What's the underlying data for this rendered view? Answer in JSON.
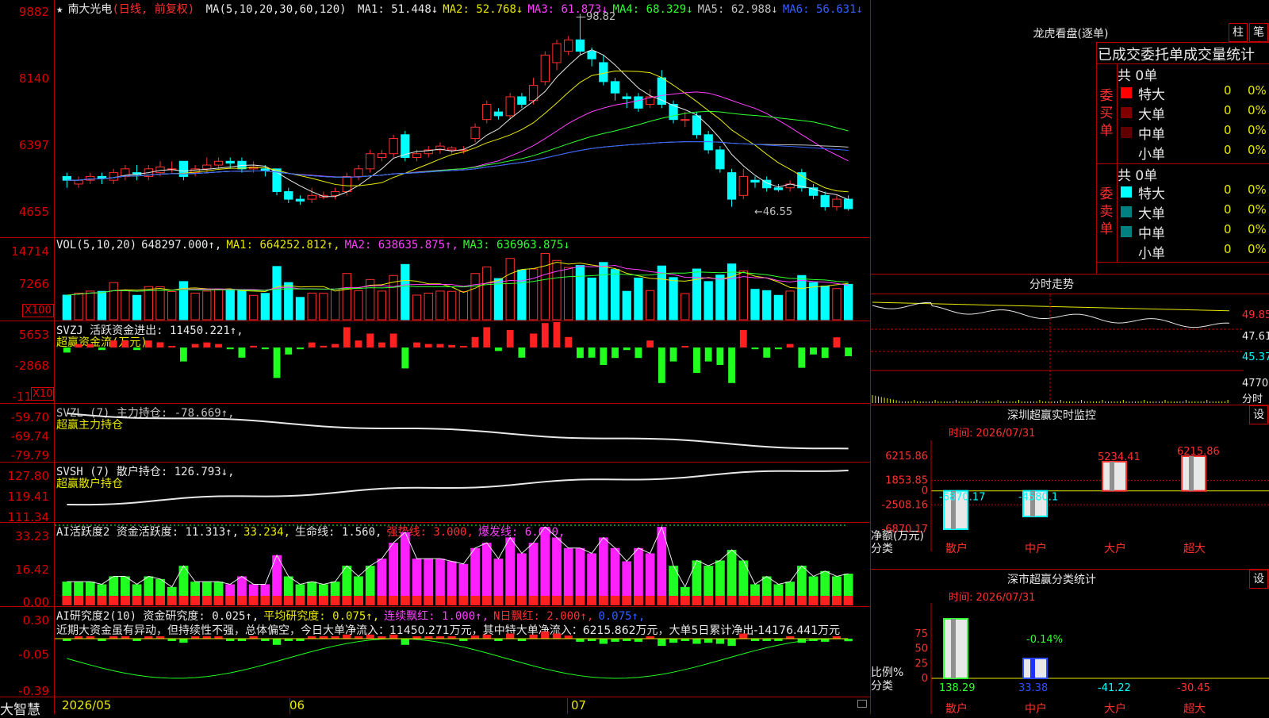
{
  "main": {
    "star": "★",
    "stock_name": "南大光电",
    "period": "(日线, 前复权)",
    "ma_params": "MA(5,10,20,30,60,120)",
    "ma": [
      {
        "label": "MA1: 51.448↓",
        "color": "#e8e8e8"
      },
      {
        "label": "MA2: 52.768↓",
        "color": "#e8e800"
      },
      {
        "label": "MA3: 61.873↓",
        "color": "#ff40ff"
      },
      {
        "label": "MA4: 68.329↓",
        "color": "#30ff30"
      },
      {
        "label": "MA5: 62.988↓",
        "color": "#c0c0c0"
      },
      {
        "label": "MA6: 56.631↓",
        "color": "#3060ff"
      }
    ],
    "y_labels": [
      "9882",
      "8140",
      "6397",
      "4655"
    ],
    "high_marker": "98.82",
    "low_marker": "←46.55",
    "candles": [
      {
        "o": 56,
        "c": 55,
        "h": 57,
        "l": 53
      },
      {
        "o": 54,
        "c": 55,
        "h": 56,
        "l": 53
      },
      {
        "o": 55,
        "c": 56,
        "h": 57,
        "l": 54
      },
      {
        "o": 56,
        "c": 55.5,
        "h": 57,
        "l": 54
      },
      {
        "o": 55,
        "c": 57,
        "h": 58,
        "l": 54
      },
      {
        "o": 56,
        "c": 58,
        "h": 59,
        "l": 55
      },
      {
        "o": 57,
        "c": 56.5,
        "h": 59,
        "l": 55
      },
      {
        "o": 56,
        "c": 58,
        "h": 59,
        "l": 55
      },
      {
        "o": 57,
        "c": 58.5,
        "h": 60,
        "l": 56
      },
      {
        "o": 58,
        "c": 58,
        "h": 60,
        "l": 57
      },
      {
        "o": 60,
        "c": 56,
        "h": 60,
        "l": 55
      },
      {
        "o": 57,
        "c": 58,
        "h": 59,
        "l": 56
      },
      {
        "o": 58,
        "c": 59,
        "h": 61,
        "l": 57
      },
      {
        "o": 59,
        "c": 60,
        "h": 61,
        "l": 58
      },
      {
        "o": 60,
        "c": 59.5,
        "h": 61,
        "l": 58
      },
      {
        "o": 60,
        "c": 58,
        "h": 61,
        "l": 57
      },
      {
        "o": 58,
        "c": 58.5,
        "h": 60,
        "l": 57
      },
      {
        "o": 58,
        "c": 57.5,
        "h": 59,
        "l": 56
      },
      {
        "o": 58,
        "c": 52,
        "h": 58,
        "l": 51
      },
      {
        "o": 52,
        "c": 50,
        "h": 53,
        "l": 49
      },
      {
        "o": 50,
        "c": 49.5,
        "h": 51,
        "l": 48.5
      },
      {
        "o": 50,
        "c": 51,
        "h": 53,
        "l": 49
      },
      {
        "o": 50.5,
        "c": 51,
        "h": 52,
        "l": 50
      },
      {
        "o": 51,
        "c": 52,
        "h": 53,
        "l": 50
      },
      {
        "o": 52,
        "c": 56,
        "h": 57,
        "l": 51
      },
      {
        "o": 56,
        "c": 58,
        "h": 59,
        "l": 55
      },
      {
        "o": 58,
        "c": 62,
        "h": 63,
        "l": 57
      },
      {
        "o": 61,
        "c": 62,
        "h": 63,
        "l": 60
      },
      {
        "o": 62,
        "c": 66,
        "h": 67,
        "l": 61
      },
      {
        "o": 67,
        "c": 61,
        "h": 68,
        "l": 60
      },
      {
        "o": 61,
        "c": 62,
        "h": 63,
        "l": 60
      },
      {
        "o": 62,
        "c": 63,
        "h": 64,
        "l": 61
      },
      {
        "o": 63,
        "c": 64,
        "h": 65,
        "l": 62
      },
      {
        "o": 63,
        "c": 63.5,
        "h": 64,
        "l": 62
      },
      {
        "o": 63,
        "c": 63,
        "h": 64,
        "l": 62
      },
      {
        "o": 66,
        "c": 69,
        "h": 70,
        "l": 65
      },
      {
        "o": 71,
        "c": 75,
        "h": 76,
        "l": 70
      },
      {
        "o": 73,
        "c": 72,
        "h": 74,
        "l": 71
      },
      {
        "o": 72,
        "c": 77,
        "h": 78,
        "l": 71
      },
      {
        "o": 77,
        "c": 75,
        "h": 78,
        "l": 74
      },
      {
        "o": 76,
        "c": 80,
        "h": 82,
        "l": 75
      },
      {
        "o": 81,
        "c": 88,
        "h": 89,
        "l": 80
      },
      {
        "o": 86,
        "c": 91,
        "h": 92,
        "l": 84
      },
      {
        "o": 89,
        "c": 92,
        "h": 93,
        "l": 88
      },
      {
        "o": 92,
        "c": 89,
        "h": 98.82,
        "l": 88
      },
      {
        "o": 89,
        "c": 87,
        "h": 90,
        "l": 85
      },
      {
        "o": 86,
        "c": 81,
        "h": 88,
        "l": 80
      },
      {
        "o": 81,
        "c": 78,
        "h": 82,
        "l": 76
      },
      {
        "o": 77,
        "c": 76.5,
        "h": 78,
        "l": 74
      },
      {
        "o": 77,
        "c": 74,
        "h": 78,
        "l": 73
      },
      {
        "o": 75,
        "c": 77,
        "h": 79,
        "l": 74
      },
      {
        "o": 82,
        "c": 75,
        "h": 84,
        "l": 74
      },
      {
        "o": 75,
        "c": 71,
        "h": 76,
        "l": 70
      },
      {
        "o": 71,
        "c": 71,
        "h": 73,
        "l": 69
      },
      {
        "o": 72,
        "c": 67,
        "h": 73,
        "l": 66
      },
      {
        "o": 67,
        "c": 63,
        "h": 68,
        "l": 62
      },
      {
        "o": 63,
        "c": 58,
        "h": 64,
        "l": 57
      },
      {
        "o": 57,
        "c": 50,
        "h": 58,
        "l": 48
      },
      {
        "o": 51,
        "c": 56,
        "h": 58,
        "l": 50
      },
      {
        "o": 55,
        "c": 54.5,
        "h": 56,
        "l": 53
      },
      {
        "o": 55,
        "c": 53,
        "h": 56,
        "l": 52
      },
      {
        "o": 53,
        "c": 52.5,
        "h": 54,
        "l": 52
      },
      {
        "o": 53,
        "c": 54,
        "h": 55,
        "l": 52
      },
      {
        "o": 57,
        "c": 53,
        "h": 58,
        "l": 52
      },
      {
        "o": 53,
        "c": 51,
        "h": 54,
        "l": 50
      },
      {
        "o": 51,
        "c": 48,
        "h": 52,
        "l": 47
      },
      {
        "o": 48,
        "c": 50,
        "h": 51,
        "l": 47
      },
      {
        "o": 50,
        "c": 47.5,
        "h": 51,
        "l": 47
      }
    ]
  },
  "vol": {
    "legend_prefix": "VOL(5,10,20)",
    "value": "648297.000↑,",
    "ma1": "MA1: 664252.812↑,",
    "ma2": "MA2: 638635.875↑,",
    "ma3": "MA3: 636963.875↓",
    "y_labels": [
      "14714",
      "7266"
    ],
    "unit": "X100"
  },
  "svzj": {
    "legend_a": "SVZJ  活跃资金进出: 11450.221↑,",
    "legend_b": "超赢资金流(万元)",
    "y_labels": [
      "5653",
      "-2868",
      "-11"
    ],
    "unit": "X10"
  },
  "svzl": {
    "legend_a": "SVZL (7) 主力持仓: -78.669↑,",
    "legend_b": "超赢主力持仓",
    "y_labels": [
      "-59.70",
      "-69.74",
      "-79.79"
    ]
  },
  "svsh": {
    "legend_a": "SVSH (7) 散户持仓: 126.793↓,",
    "legend_b": "超赢散户持仓",
    "y_labels": [
      "127.80",
      "119.41",
      "111.34"
    ]
  },
  "ai1": {
    "legend_a": "AI活跃度2 资金活跃度: 11.313↑,",
    "legend_b": "33.234,",
    "legend_c": "生命线: 1.560,",
    "legend_d": "强势线: 3.000,",
    "legend_e": "爆发线: 6.000,",
    "y_labels": [
      "33.23",
      "16.42",
      "0.00"
    ]
  },
  "ai2": {
    "legend_a": "AI研究度2(10) 资金研究度: 0.025↑,",
    "legend_b": "平均研究度: 0.075↑,",
    "legend_c": "连续飘红: 1.000↑,",
    "legend_d": "N日飘红: 2.000↑,",
    "legend_e": "0.075↑,",
    "comment": "近期大资金虽有异动，但持续性不强，总体偏空，今日大单净流入：11450.271万元，其中特大单净流入：6215.862万元，大单5日累计净出-14176.441万元",
    "y_labels": [
      "0.30",
      "-0.05",
      "-0.39"
    ]
  },
  "bottom": {
    "brand": "大智慧",
    "dates": [
      "2026/05",
      "06",
      "07"
    ]
  },
  "lhb": {
    "title": "龙虎看盘(逐单)",
    "btn1": "柱",
    "btn2": "笔",
    "header": "已成交委托单成交量统计",
    "buy_total": "共 0单",
    "buy_label": "委买单",
    "sell_total": "共 0单",
    "sell_label": "委卖单",
    "buy_rows": [
      {
        "label": "特大",
        "v": "0",
        "p": "0%",
        "color": "#ff0000"
      },
      {
        "label": "大单",
        "v": "0",
        "p": "0%",
        "color": "#800000"
      },
      {
        "label": "中单",
        "v": "0",
        "p": "0%",
        "color": "#600000"
      },
      {
        "label": "小单",
        "v": "0",
        "p": "0%",
        "color": "#000000"
      }
    ],
    "sell_rows": [
      {
        "label": "特大",
        "v": "0",
        "p": "0%",
        "color": "#00ffff"
      },
      {
        "label": "大单",
        "v": "0",
        "p": "0%",
        "color": "#008080"
      },
      {
        "label": "中单",
        "v": "0",
        "p": "0%",
        "color": "#008080"
      },
      {
        "label": "小单",
        "v": "0",
        "p": "0%",
        "color": "#000000"
      }
    ]
  },
  "intraday": {
    "title": "分时走势",
    "y_labels": [
      "49.85",
      "47.61",
      "45.37",
      "4770"
    ],
    "unit": "分时"
  },
  "monitor": {
    "title": "深圳超赢实时监控",
    "btn": "设",
    "time": "时间: 2026/07/31",
    "y_labels": [
      "6215.86",
      "1853.85",
      "0",
      "-2508.16",
      "-6870.17"
    ],
    "y_title": "净额(万元)",
    "x_title": "分类",
    "bars": [
      {
        "cat": "散户",
        "value": -6870.17,
        "label": "-6870.17",
        "color": "#00ffff"
      },
      {
        "cat": "中户",
        "value": -4580.1,
        "label": "-4580.1",
        "color": "#00ffff"
      },
      {
        "cat": "大户",
        "value": 5234.41,
        "label": "5234.41",
        "color": "#ff3030"
      },
      {
        "cat": "超大",
        "value": 6215.86,
        "label": "6215.86",
        "color": "#ff3030"
      }
    ]
  },
  "classify": {
    "title": "深市超赢分类统计",
    "btn": "设",
    "time": "时间: 2026/07/31",
    "y_labels": [
      "75",
      "50",
      "25",
      "0"
    ],
    "y_title": "比例%",
    "x_title": "分类",
    "bars": [
      {
        "cat": "散户",
        "value": 138.29,
        "label": "138.29",
        "color": "#30ff30"
      },
      {
        "cat": "中户",
        "value": 33.38,
        "label": "33.38",
        "color": "#3050ff"
      },
      {
        "cat": "大户",
        "value": -41.22,
        "label": "-41.22",
        "color": "#00ffff"
      },
      {
        "cat": "超大",
        "value": -30.45,
        "label": "-30.45",
        "color": "#ff3030"
      }
    ],
    "extra_label": "-0.14%"
  }
}
